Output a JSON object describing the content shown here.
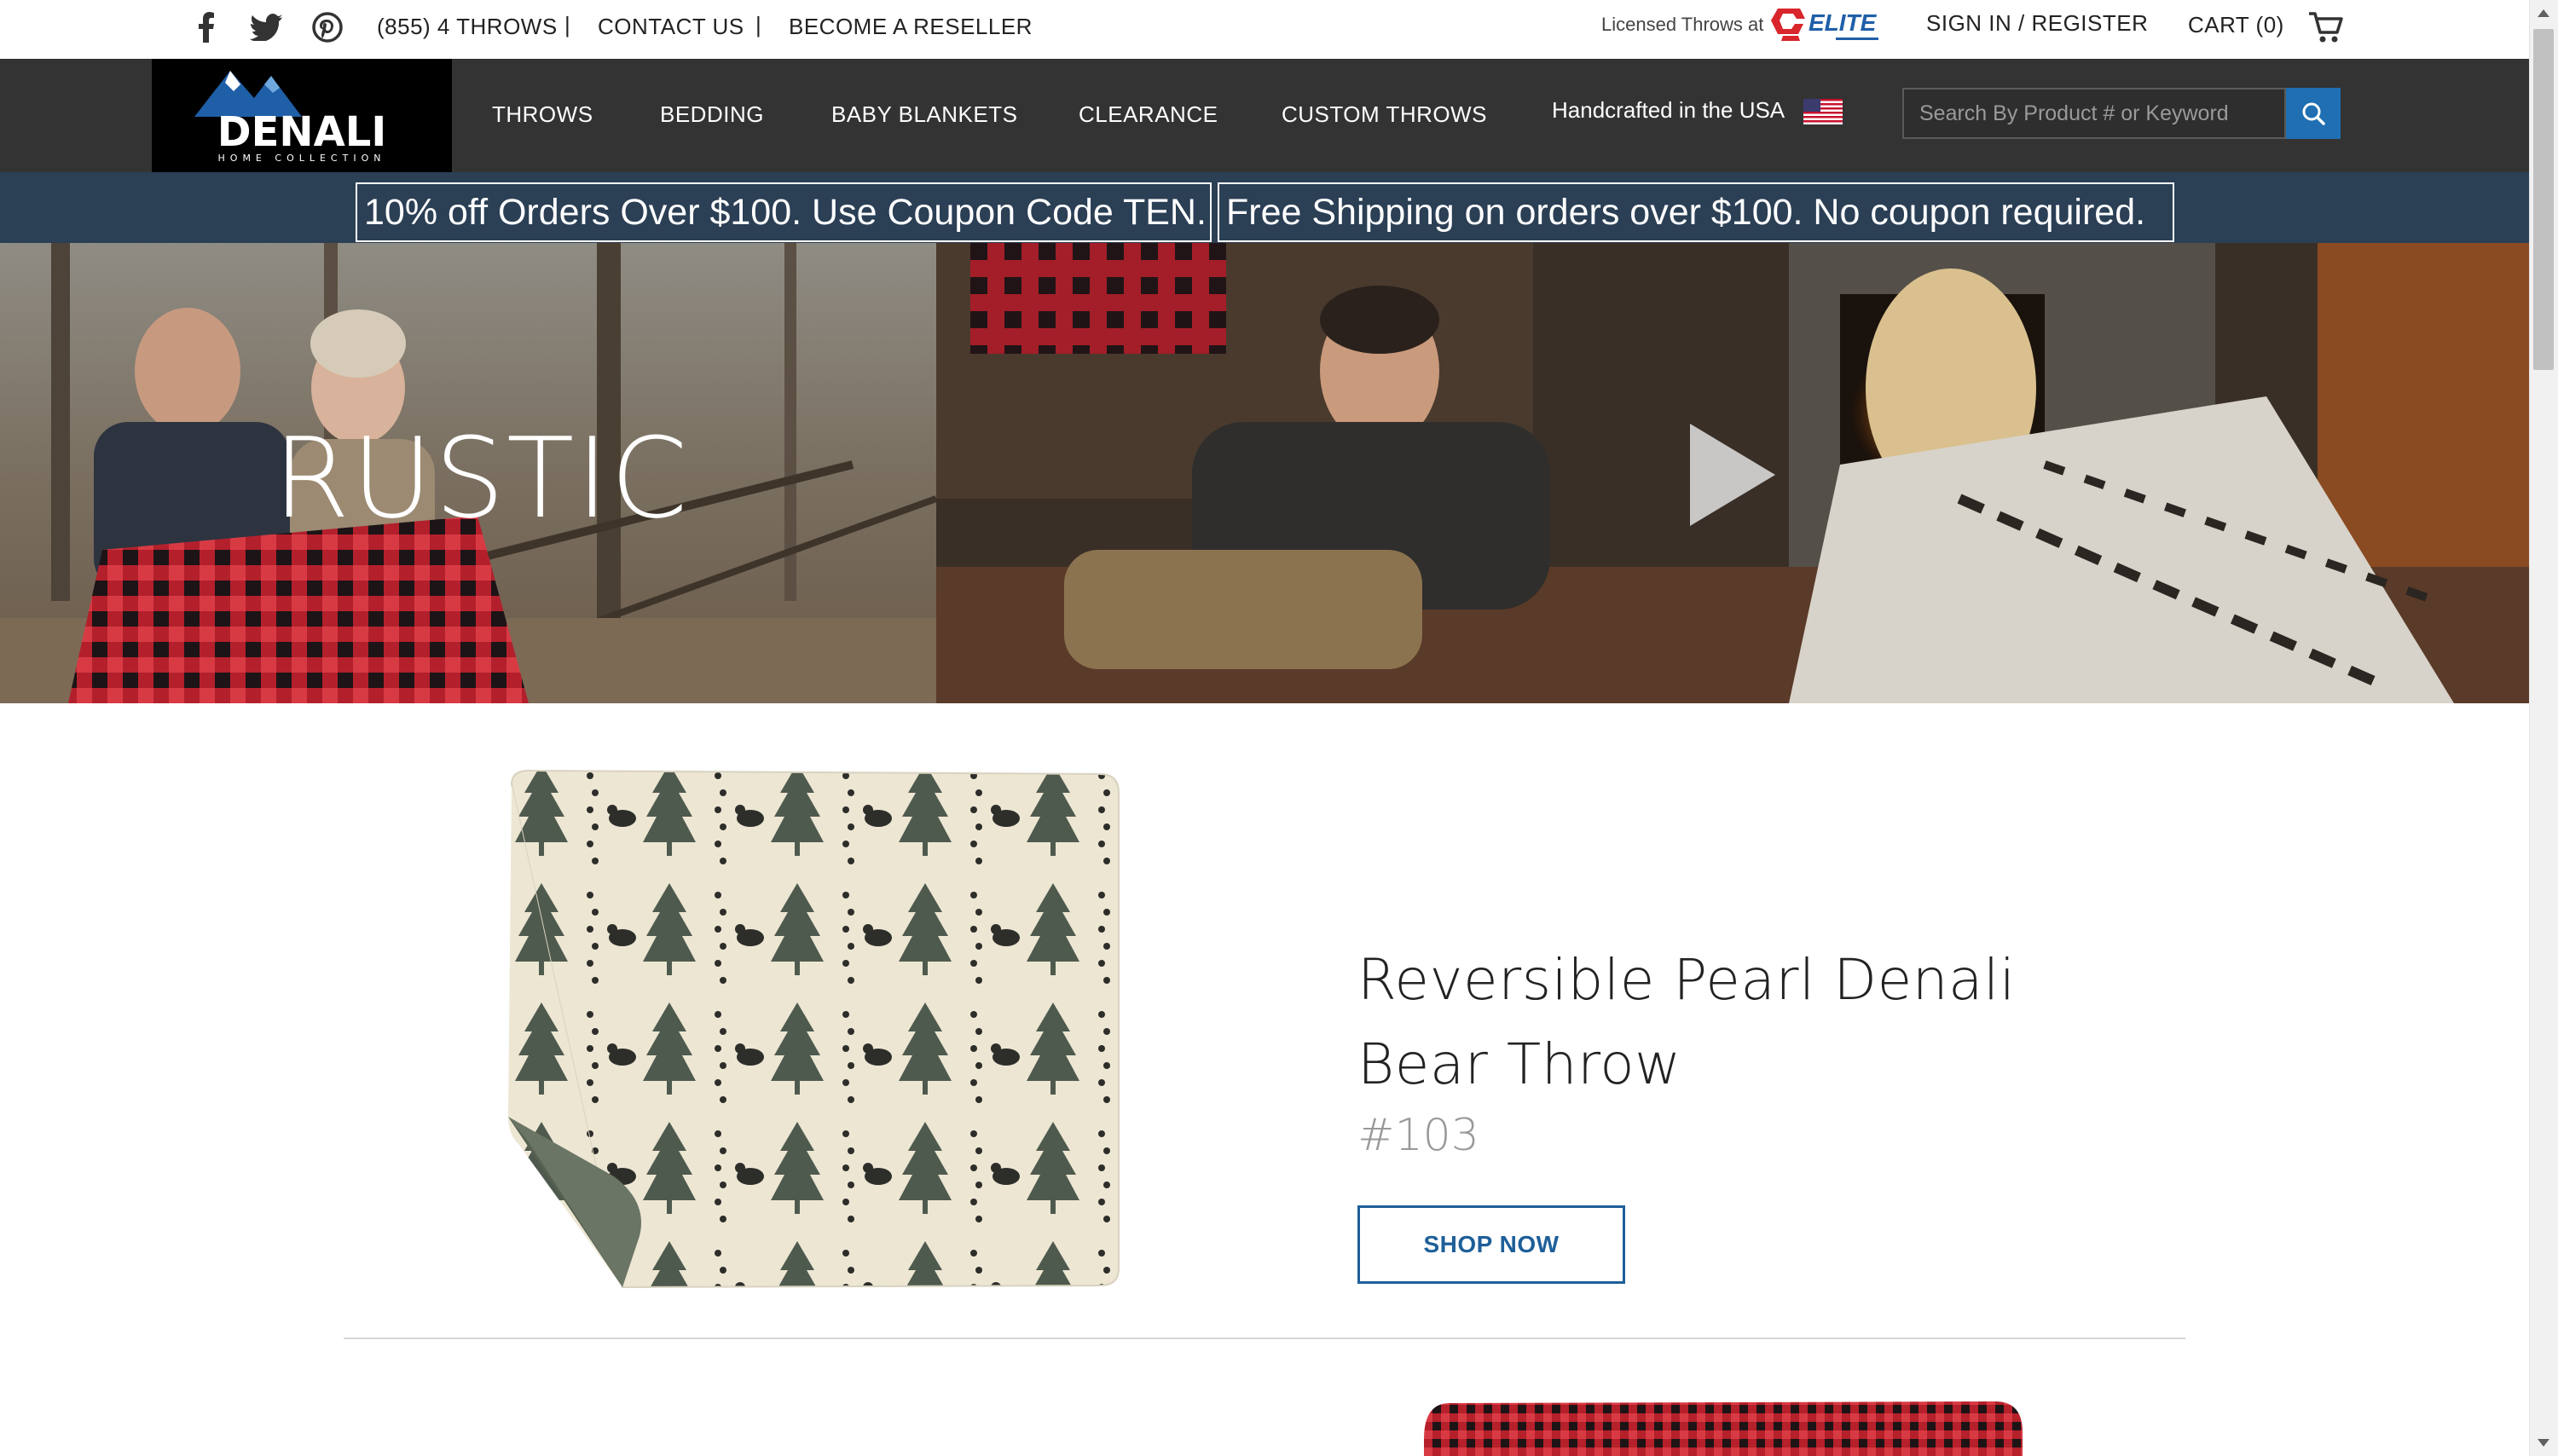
{
  "topbar": {
    "social": [
      "facebook-icon",
      "twitter-icon",
      "pinterest-icon"
    ],
    "phone": "(855) 4 THROWS",
    "separator": "|",
    "contact": "CONTACT US",
    "reseller": "BECOME A RESELLER",
    "licensed": "Licensed Throws at",
    "elite_logo_text": "ELITE",
    "signin": "SIGN IN / REGISTER",
    "cart": "CART (0)"
  },
  "nav": {
    "logo_text": "DENALI",
    "logo_sub": "HOME COLLECTION",
    "items": [
      "THROWS",
      "BEDDING",
      "BABY BLANKETS",
      "CLEARANCE",
      "CUSTOM THROWS"
    ],
    "handcrafted": "Handcrafted in the USA",
    "search_placeholder": "Search By Product # or Keyword"
  },
  "promo": {
    "coupon": "10% off Orders Over $100. Use Coupon Code TEN.",
    "shipping": "Free Shipping on orders over $100. No coupon required."
  },
  "hero": {
    "title": "RUSTIC"
  },
  "product": {
    "title": "Reversible Pearl Denali Bear Throw",
    "sku": "#103",
    "cta": "SHOP NOW"
  },
  "colors": {
    "nav_bg": "#333333",
    "promo_bg": "#2b3f55",
    "accent_blue": "#1e5f99",
    "search_btn": "#1f6fb2",
    "elite_red": "#d8262c",
    "elite_blue": "#1f5fa8"
  }
}
